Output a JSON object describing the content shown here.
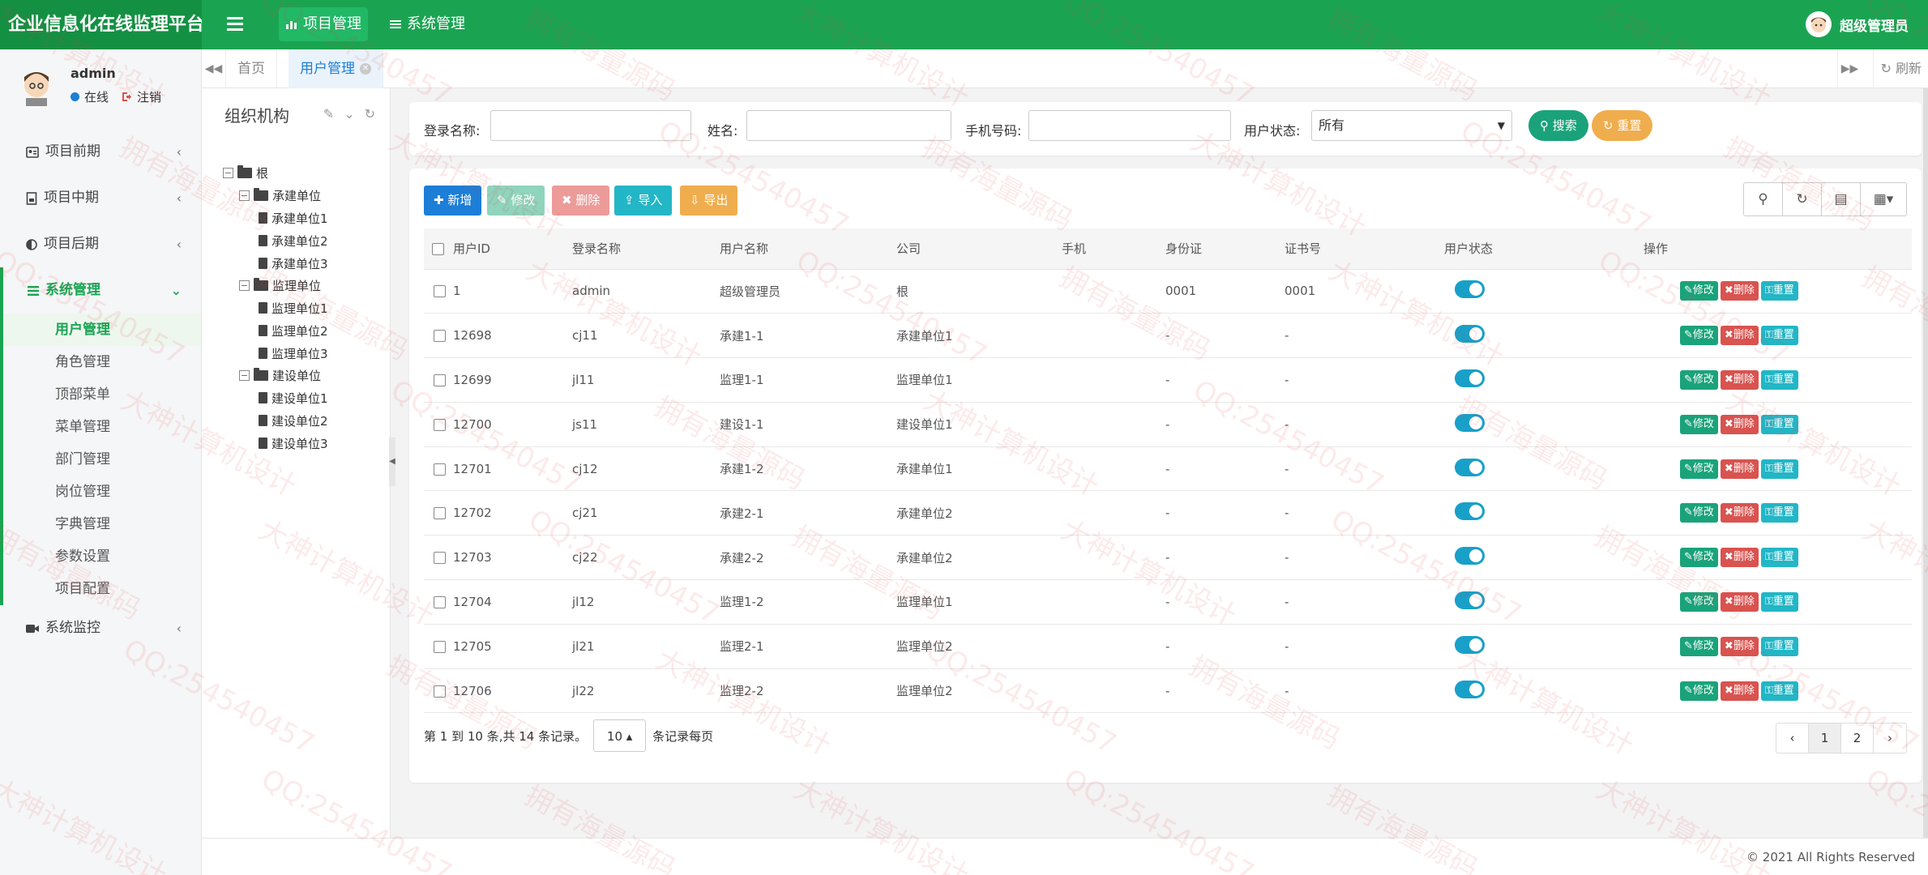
{
  "app": {
    "title": "企业信息化在线监理平台"
  },
  "topnav": [
    {
      "label": "项目管理",
      "icon": "bar-chart-icon",
      "active": true
    },
    {
      "label": "系统管理",
      "icon": "list-icon",
      "active": false
    }
  ],
  "user_top": {
    "name": "超级管理员"
  },
  "profile": {
    "name": "admin",
    "status": "在线",
    "logout": "注销"
  },
  "sidebar": {
    "items": [
      {
        "label": "项目前期",
        "icon": "id-card-icon"
      },
      {
        "label": "项目中期",
        "icon": "document-icon"
      },
      {
        "label": "项目后期",
        "icon": "half-circle-icon"
      }
    ],
    "group": {
      "label": "系统管理",
      "children": [
        "用户管理",
        "角色管理",
        "顶部菜单",
        "菜单管理",
        "部门管理",
        "岗位管理",
        "字典管理",
        "参数设置",
        "项目配置"
      ],
      "active_index": 0
    },
    "after": [
      {
        "label": "系统监控",
        "icon": "video-icon"
      }
    ]
  },
  "tabs": {
    "items": [
      "首页",
      "用户管理"
    ],
    "refresh": "刷新"
  },
  "org": {
    "title": "组织机构",
    "tree": {
      "root": "根",
      "groups": [
        {
          "label": "承建单位",
          "children": [
            "承建单位1",
            "承建单位2",
            "承建单位3"
          ]
        },
        {
          "label": "监理单位",
          "children": [
            "监理单位1",
            "监理单位2",
            "监理单位3"
          ]
        },
        {
          "label": "建设单位",
          "children": [
            "建设单位1",
            "建设单位2",
            "建设单位3"
          ]
        }
      ]
    }
  },
  "search": {
    "login_name_label": "登录名称:",
    "name_label": "姓名:",
    "phone_label": "手机号码:",
    "status_label": "用户状态:",
    "status_value": "所有",
    "search_btn": "搜索",
    "reset_btn": "重置"
  },
  "toolbar": {
    "add": "新增",
    "edit": "修改",
    "delete": "删除",
    "import": "导入",
    "export": "导出"
  },
  "table": {
    "headers": [
      "用户ID",
      "登录名称",
      "用户名称",
      "公司",
      "手机",
      "身份证",
      "证书号",
      "用户状态",
      "操作"
    ],
    "ops": {
      "edit": "修改",
      "delete": "删除",
      "reset": "重置"
    },
    "rows": [
      {
        "id": "1",
        "login": "admin",
        "name": "超级管理员",
        "company": "根",
        "phone": "",
        "idcard": "0001",
        "cert": "0001",
        "enabled": true
      },
      {
        "id": "12698",
        "login": "cj11",
        "name": "承建1-1",
        "company": "承建单位1",
        "phone": "",
        "idcard": "-",
        "cert": "-",
        "enabled": true
      },
      {
        "id": "12699",
        "login": "jl11",
        "name": "监理1-1",
        "company": "监理单位1",
        "phone": "",
        "idcard": "-",
        "cert": "-",
        "enabled": true
      },
      {
        "id": "12700",
        "login": "js11",
        "name": "建设1-1",
        "company": "建设单位1",
        "phone": "",
        "idcard": "-",
        "cert": "-",
        "enabled": true
      },
      {
        "id": "12701",
        "login": "cj12",
        "name": "承建1-2",
        "company": "承建单位1",
        "phone": "",
        "idcard": "-",
        "cert": "-",
        "enabled": true
      },
      {
        "id": "12702",
        "login": "cj21",
        "name": "承建2-1",
        "company": "承建单位2",
        "phone": "",
        "idcard": "-",
        "cert": "-",
        "enabled": true
      },
      {
        "id": "12703",
        "login": "cj22",
        "name": "承建2-2",
        "company": "承建单位2",
        "phone": "",
        "idcard": "-",
        "cert": "-",
        "enabled": true
      },
      {
        "id": "12704",
        "login": "jl12",
        "name": "监理1-2",
        "company": "监理单位1",
        "phone": "",
        "idcard": "-",
        "cert": "-",
        "enabled": true
      },
      {
        "id": "12705",
        "login": "jl21",
        "name": "监理2-1",
        "company": "监理单位2",
        "phone": "",
        "idcard": "-",
        "cert": "-",
        "enabled": true
      },
      {
        "id": "12706",
        "login": "jl22",
        "name": "监理2-2",
        "company": "监理单位2",
        "phone": "",
        "idcard": "-",
        "cert": "-",
        "enabled": true
      }
    ]
  },
  "pagination": {
    "info": "第 1 到 10 条,共 14 条记录。",
    "page_size": "10",
    "per_page_label": "条记录每页",
    "pages": [
      "‹",
      "1",
      "2",
      "›"
    ],
    "current": "1"
  },
  "footer": {
    "copyright": "© 2021 All Rights Reserved"
  },
  "watermark": [
    "大神计算机设计",
    "QQ:254540457",
    "拥有海量源码"
  ],
  "colors": {
    "primary": "#1aa452",
    "blue": "#1c7ed6",
    "danger": "#d9534f",
    "info": "#22b6c6",
    "warning": "#f0ad4e"
  }
}
